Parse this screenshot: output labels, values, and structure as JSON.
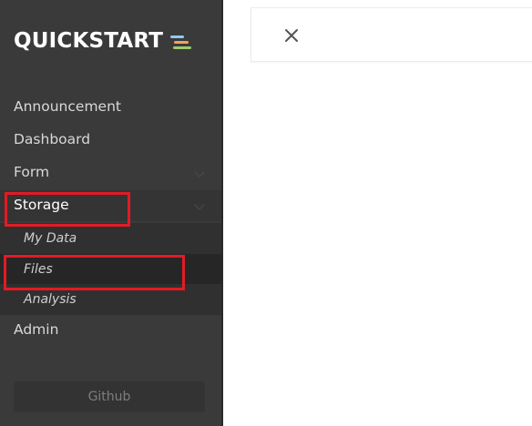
{
  "sidebar": {
    "brand": {
      "title": "QUICKSTART",
      "icon": "stacked-lines-icon",
      "icon_colors": [
        "#8ecaf6",
        "#f0a35f",
        "#9ccc6a"
      ]
    },
    "menu": [
      {
        "label": "Announcement"
      },
      {
        "label": "Dashboard"
      },
      {
        "label": "Form",
        "has_chevron": true
      },
      {
        "label": "Storage",
        "active": true,
        "has_chevron": true
      },
      {
        "label": "My Data"
      },
      {
        "label": "Files",
        "current": true
      },
      {
        "label": "Analysis"
      },
      {
        "label": "Admin"
      }
    ],
    "github_label": "Github"
  },
  "main": {
    "close_icon": "close-icon"
  },
  "annotations": {
    "color": "#e21b24"
  }
}
